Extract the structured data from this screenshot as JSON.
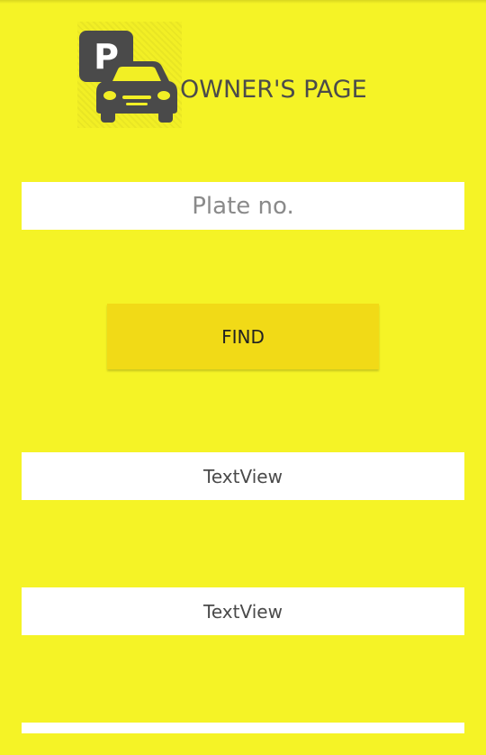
{
  "header": {
    "logo_icon": "parking-car-icon",
    "logo_letter": "P",
    "title": "OWNER'S PAGE"
  },
  "form": {
    "plate_placeholder": "Plate no.",
    "plate_value": "",
    "find_label": "FIND"
  },
  "results": {
    "text_view_1": "TextView",
    "text_view_2": "TextView",
    "text_view_3": ""
  },
  "colors": {
    "background": "#f5f326",
    "button": "#f1da17",
    "field": "#ffffff",
    "text": "#4b4b4b"
  }
}
